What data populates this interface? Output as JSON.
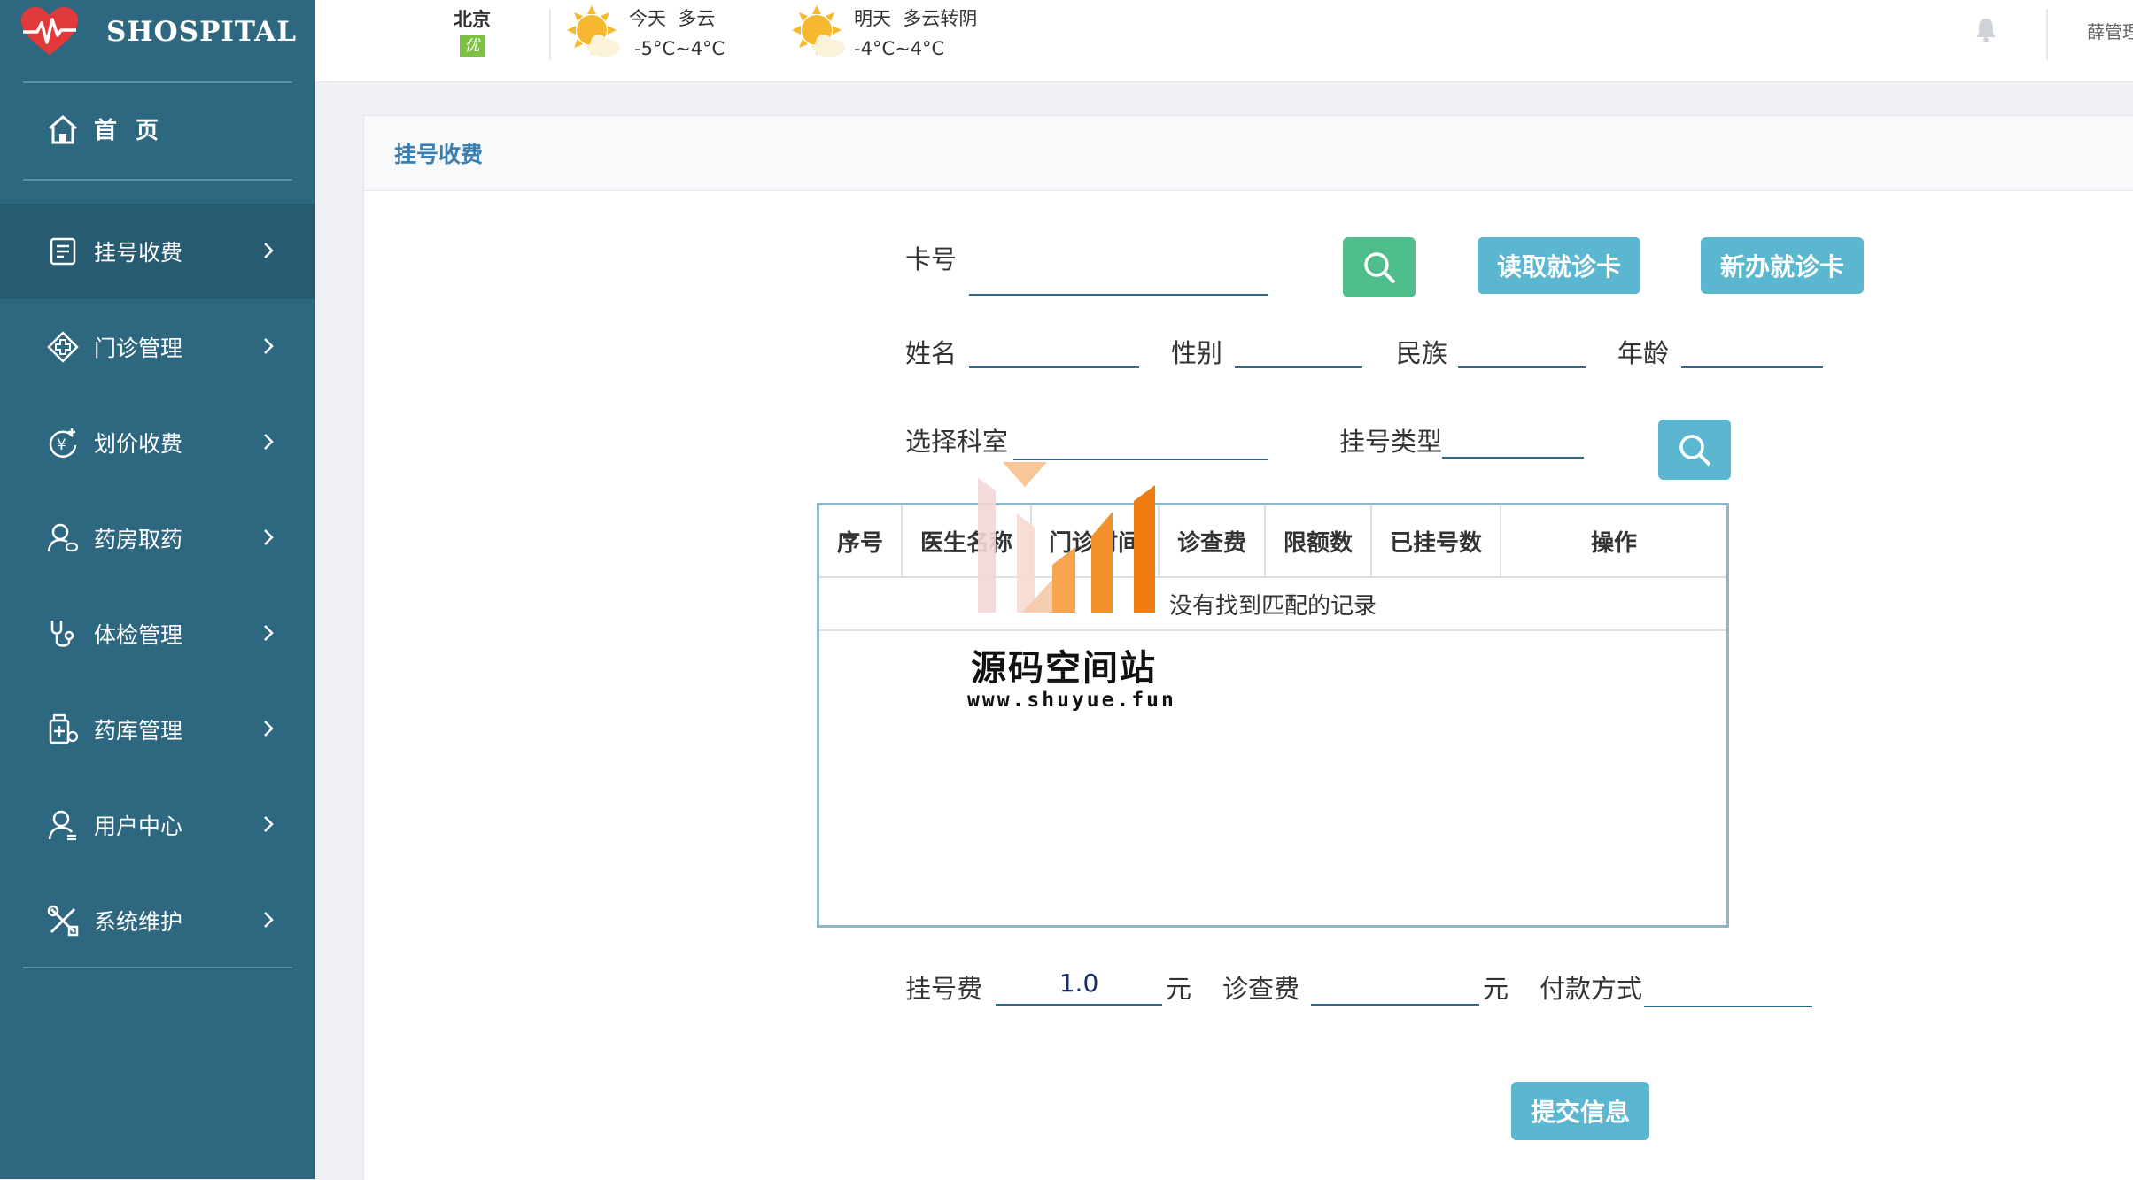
{
  "app": {
    "name": "SHOSPITAL"
  },
  "sidebar": {
    "home_label": "首 页",
    "items": [
      {
        "label": "挂号收费",
        "icon": "register-icon",
        "active": true
      },
      {
        "label": "门诊管理",
        "icon": "clinic-icon"
      },
      {
        "label": "划价收费",
        "icon": "pricing-icon"
      },
      {
        "label": "药房取药",
        "icon": "pharmacy-icon"
      },
      {
        "label": "体检管理",
        "icon": "stethoscope-icon"
      },
      {
        "label": "药库管理",
        "icon": "drug-store-icon"
      },
      {
        "label": "用户中心",
        "icon": "user-icon"
      },
      {
        "label": "系统维护",
        "icon": "tools-icon"
      }
    ]
  },
  "topbar": {
    "city": "北京",
    "aqi": "优",
    "today": {
      "label": "今天",
      "cond": "多云",
      "temp": "-5°C~4°C"
    },
    "tomorrow": {
      "label": "明天",
      "cond": "多云转阴",
      "temp": "-4°C~4°C"
    },
    "user": "薛管理"
  },
  "panel": {
    "title": "挂号收费"
  },
  "form": {
    "card_no_label": "卡号",
    "read_card_button": "读取就诊卡",
    "new_card_button": "新办就诊卡",
    "name_label": "姓名",
    "gender_label": "性别",
    "ethnicity_label": "民族",
    "age_label": "年龄",
    "dept_label": "选择科室",
    "reg_type_label": "挂号类型",
    "reg_fee_label": "挂号费",
    "reg_fee_value": "1.0",
    "yuan1": "元",
    "exam_fee_label": "诊查费",
    "yuan2": "元",
    "pay_label": "付款方式",
    "submit_button": "提交信息"
  },
  "table": {
    "headers": [
      "序号",
      "医生名称",
      "门诊时间",
      "诊查费",
      "限额数",
      "已挂号数",
      "操作"
    ],
    "empty_text": "没有找到匹配的记录"
  },
  "watermark": {
    "title": "源码空间站",
    "url": "www.shuyue.fun"
  },
  "colors": {
    "sidebar": "#2d6880",
    "accent_button": "#5bb6cf",
    "search_green": "#4fbd8c"
  }
}
